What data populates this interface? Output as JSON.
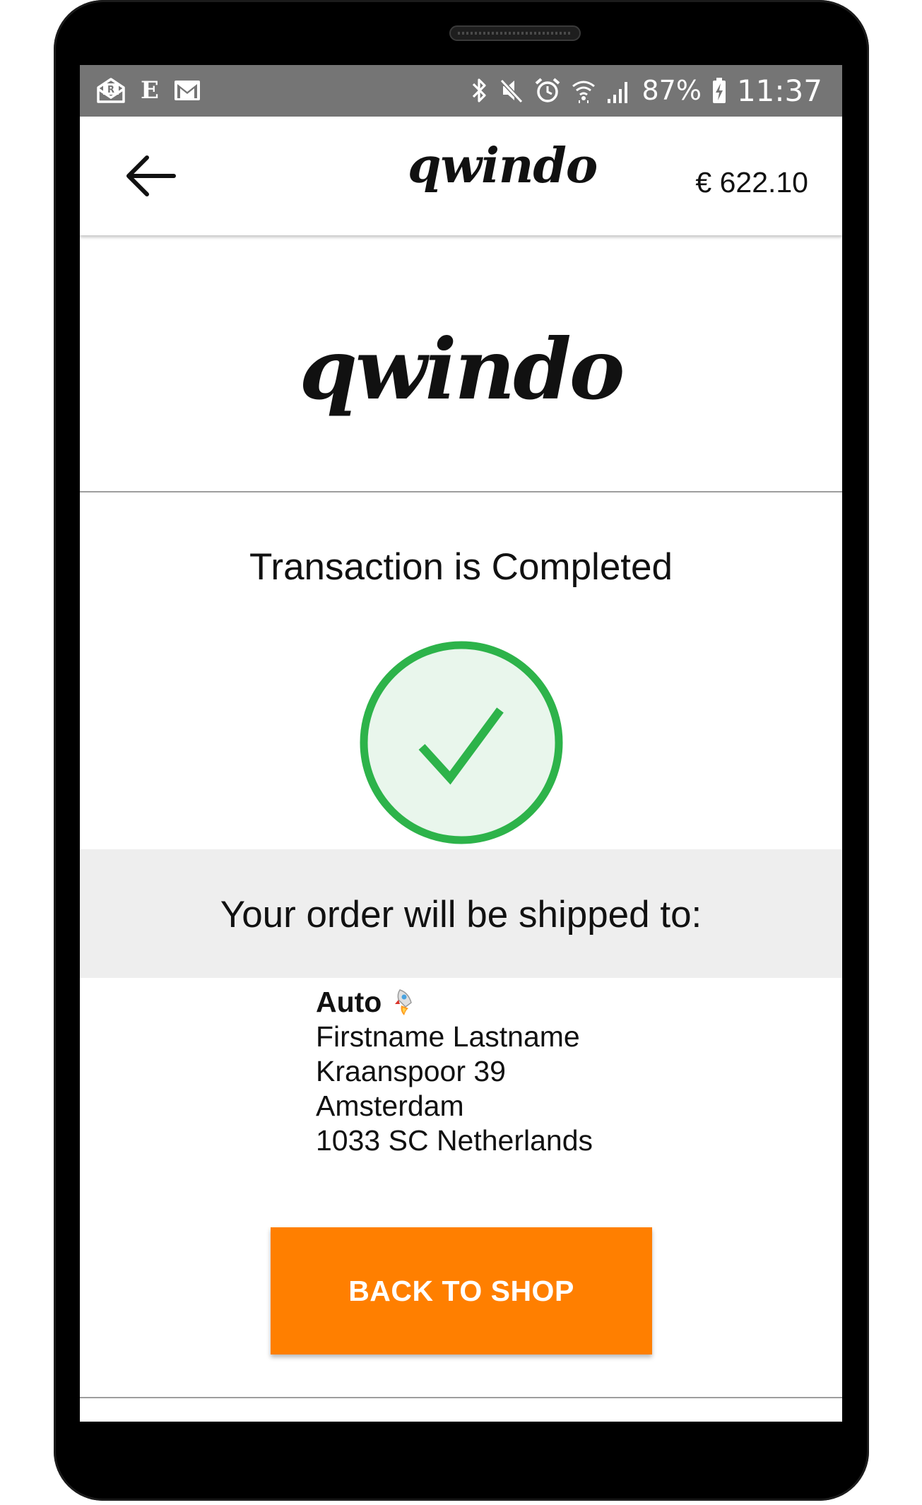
{
  "status_bar": {
    "battery_percent": "87%",
    "time": "11:37",
    "left_icons": [
      "mail-open-icon",
      "e-letter-icon",
      "gmail-icon"
    ],
    "right_icons": [
      "bluetooth-icon",
      "mute-icon",
      "alarm-icon",
      "wifi-icon",
      "signal-icon",
      "battery-charging-icon"
    ],
    "e_letter": "E"
  },
  "app_bar": {
    "back_icon": "arrow-left-icon",
    "logo": "qwindo",
    "cart_total": "€ 622.10"
  },
  "main": {
    "logo": "qwindo",
    "transaction_title": "Transaction is Completed",
    "success_icon": "check-circle-icon",
    "shipping_heading": "Your order will be shipped to:",
    "address": {
      "method": "Auto",
      "method_icon": "rocket-icon",
      "name": "Firstname Lastname",
      "street": "Kraanspoor 39",
      "city": "Amsterdam",
      "postal_country": "1033 SC Netherlands"
    },
    "back_button_label": "BACK TO SHOP"
  },
  "colors": {
    "accent": "#ff7f00",
    "success": "#2db34a",
    "success_fill": "#e9f6ec",
    "status_bar": "#757575",
    "band": "#eeeeee"
  }
}
